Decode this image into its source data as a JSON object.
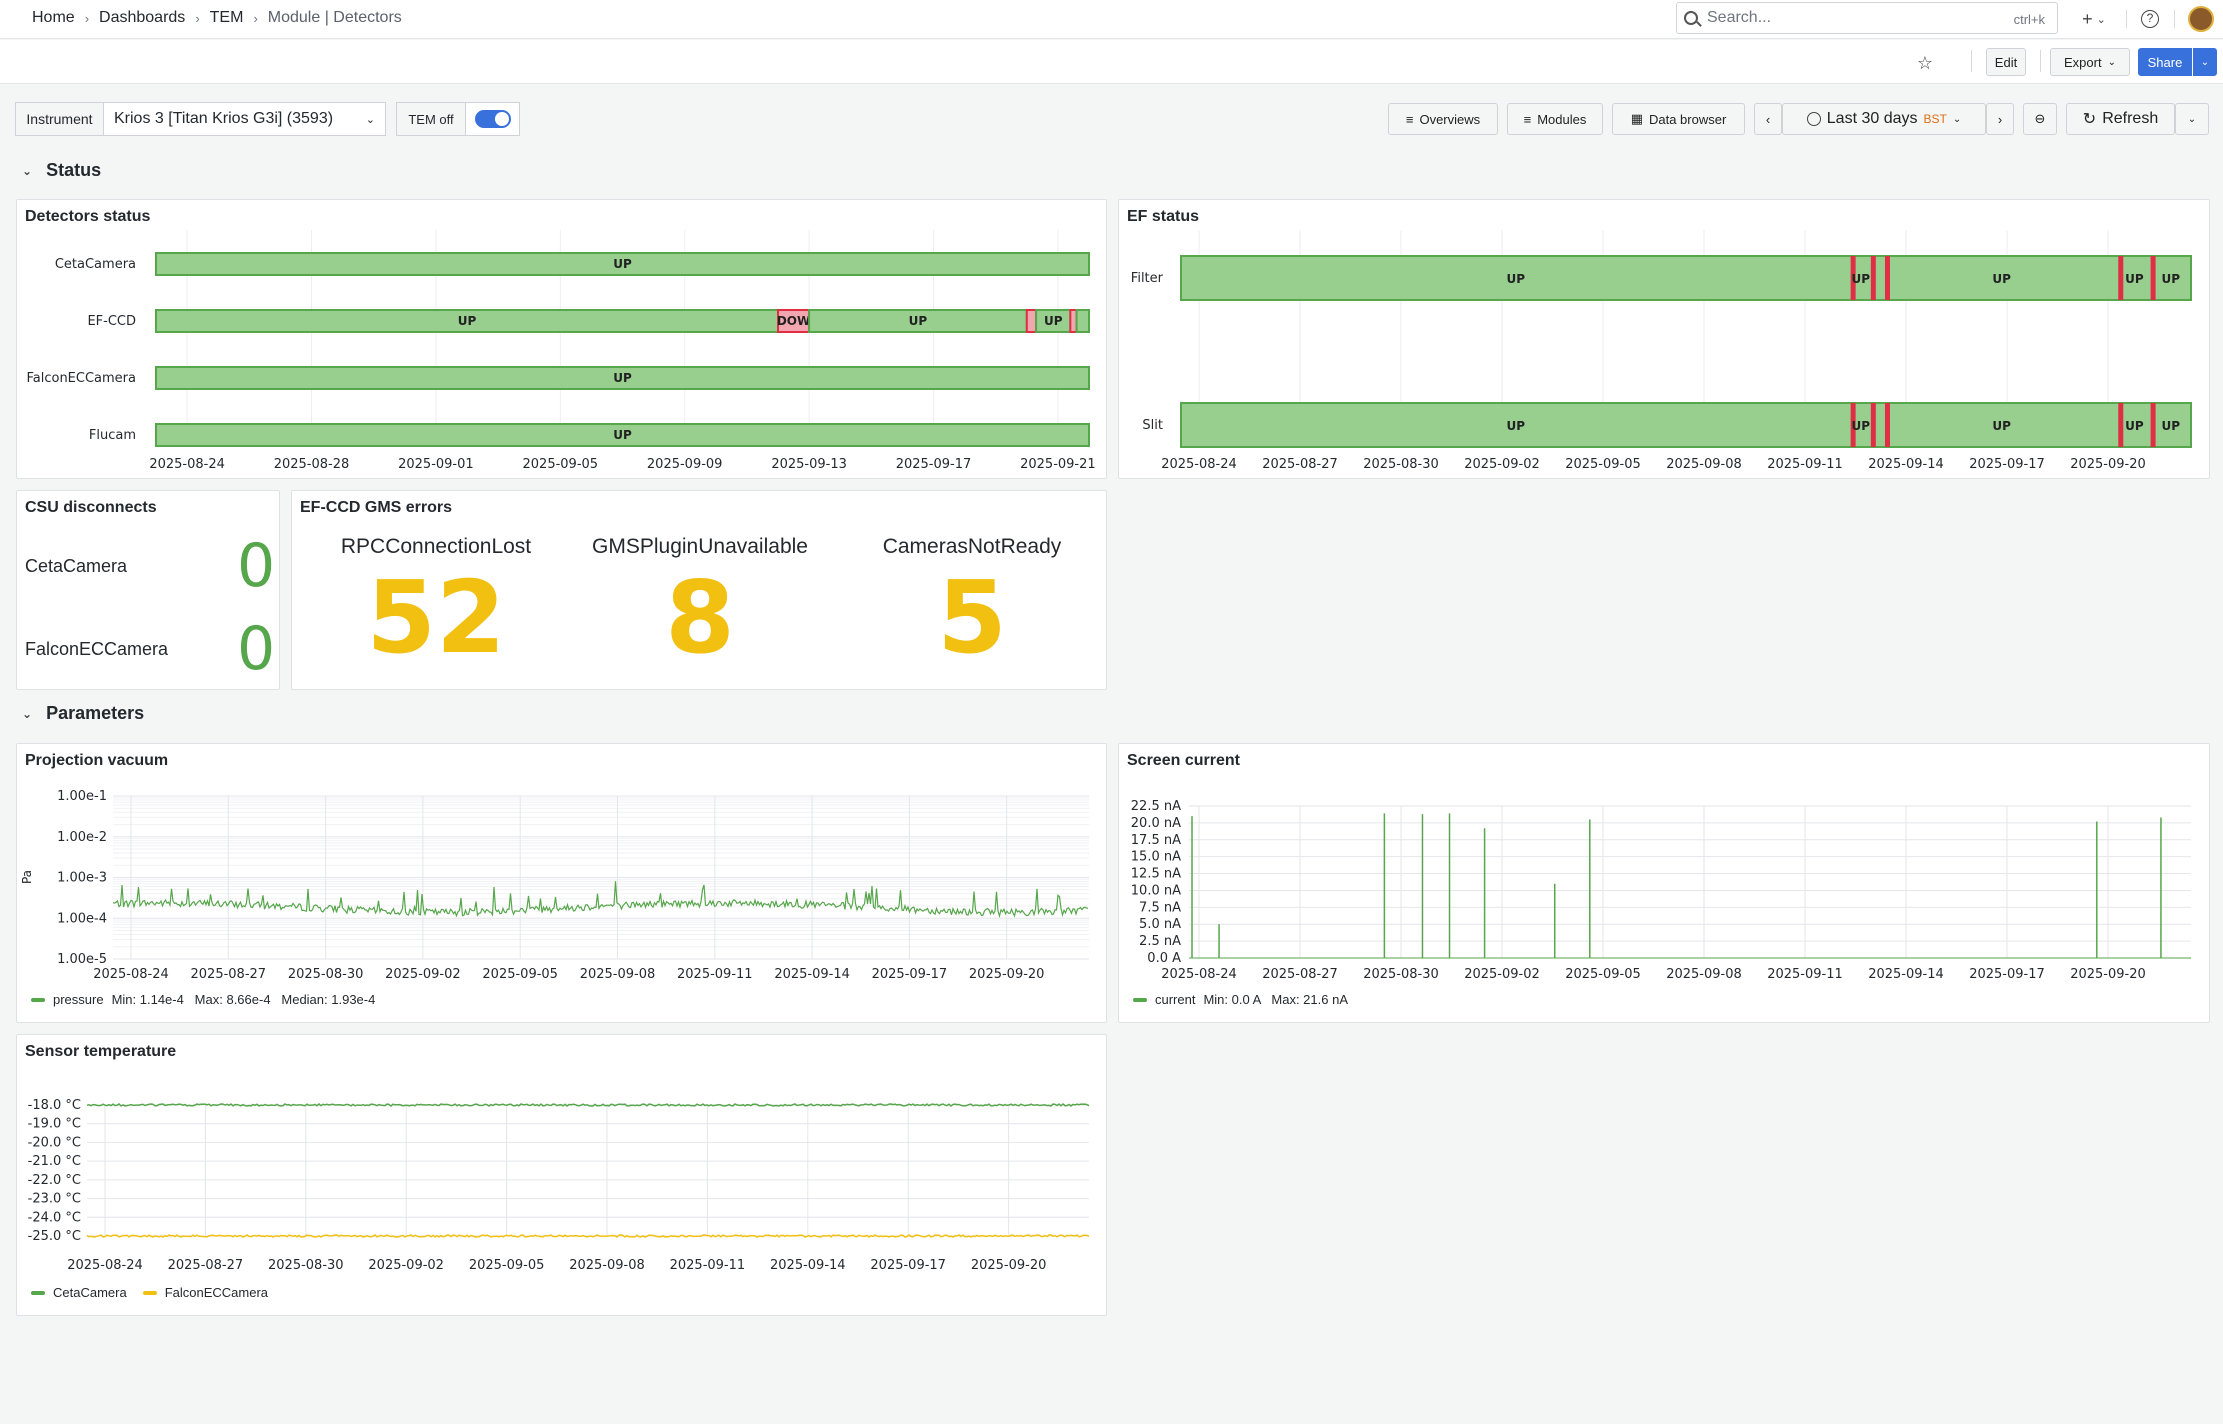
{
  "breadcrumb": {
    "items": [
      "Home",
      "Dashboards",
      "TEM"
    ],
    "current": "Module | Detectors"
  },
  "search": {
    "placeholder": "Search...",
    "shortcut": "ctrl+k"
  },
  "toolbar": {
    "edit": "Edit",
    "export": "Export",
    "share": "Share"
  },
  "controls": {
    "instrument_label": "Instrument",
    "instrument_value": "Krios 3 [Titan Krios G3i] (3593)",
    "tem_off": "TEM off",
    "tem_toggle_on": true,
    "overviews": "Overviews",
    "modules": "Modules",
    "data_browser": "Data browser",
    "time_range": "Last 30 days",
    "timezone": "BST",
    "refresh": "Refresh"
  },
  "colors": {
    "ok": "#56a64b",
    "ok_fill": "#98cf8f",
    "down": "#e02f44",
    "down_fill": "#f2a7b0",
    "warn": "#f2c011",
    "accent": "#3871dc"
  },
  "sections": {
    "status": "Status",
    "parameters": "Parameters"
  },
  "panels": {
    "detectors_status": {
      "title": "Detectors status"
    },
    "ef_status": {
      "title": "EF status"
    },
    "csu": {
      "title": "CSU disconnects",
      "items": [
        {
          "label": "CetaCamera",
          "value": "0"
        },
        {
          "label": "FalconECCamera",
          "value": "0"
        }
      ]
    },
    "gms": {
      "title": "EF-CCD GMS errors",
      "items": [
        {
          "label": "RPCConnectionLost",
          "value": "52"
        },
        {
          "label": "GMSPluginUnavailable",
          "value": "8"
        },
        {
          "label": "CamerasNotReady",
          "value": "5"
        }
      ]
    },
    "projection_vacuum": {
      "title": "Projection vacuum",
      "legend": "pressure",
      "stats": "Min: 1.14e-4   Max: 8.66e-4   Median: 1.93e-4"
    },
    "screen_current": {
      "title": "Screen current",
      "legend": "current",
      "stats": "Min: 0.0 A   Max: 21.6 nA"
    },
    "sensor_temp": {
      "title": "Sensor temperature",
      "legend": [
        "CetaCamera",
        "FalconECCamera"
      ]
    }
  },
  "chart_data": [
    {
      "type": "state-timeline",
      "title": "Detectors status",
      "x_ticks": [
        "2025-08-24",
        "2025-08-28",
        "2025-09-01",
        "2025-09-05",
        "2025-09-09",
        "2025-09-13",
        "2025-09-17",
        "2025-09-21"
      ],
      "rows": [
        {
          "name": "CetaCamera",
          "segments": [
            {
              "state": "UP",
              "from": "2025-08-23",
              "to": "2025-09-22"
            }
          ]
        },
        {
          "name": "EF-CCD",
          "segments": [
            {
              "state": "UP",
              "from": "2025-08-23",
              "to": "2025-09-12"
            },
            {
              "state": "DOWN",
              "label": "DOW",
              "from": "2025-09-12",
              "to": "2025-09-13"
            },
            {
              "state": "UP",
              "from": "2025-09-13",
              "to": "2025-09-20"
            },
            {
              "state": "DOWN",
              "from": "2025-09-20",
              "to": "2025-09-20.3"
            },
            {
              "state": "UP",
              "from": "2025-09-20.3",
              "to": "2025-09-21.4"
            },
            {
              "state": "DOWN",
              "from": "2025-09-21.4",
              "to": "2025-09-21.6"
            },
            {
              "state": "UP",
              "from": "2025-09-21.6",
              "to": "2025-09-22"
            }
          ]
        },
        {
          "name": "FalconECCamera",
          "segments": [
            {
              "state": "UP",
              "from": "2025-08-23",
              "to": "2025-09-22"
            }
          ]
        },
        {
          "name": "Flucam",
          "segments": [
            {
              "state": "UP",
              "from": "2025-08-23",
              "to": "2025-09-22"
            }
          ]
        }
      ]
    },
    {
      "type": "state-timeline",
      "title": "EF status",
      "x_ticks": [
        "2025-08-24",
        "2025-08-27",
        "2025-08-30",
        "2025-09-02",
        "2025-09-05",
        "2025-09-08",
        "2025-09-11",
        "2025-09-14",
        "2025-09-17",
        "2025-09-20"
      ],
      "rows": [
        {
          "name": "Filter",
          "up_labels": [
            "UP",
            "UP",
            "UP",
            "UP",
            "UP"
          ]
        },
        {
          "name": "Slit",
          "up_labels": [
            "UP",
            "UP",
            "UP",
            "UP",
            "UP"
          ]
        }
      ]
    },
    {
      "type": "line",
      "title": "Projection vacuum",
      "ylabel": "Pa",
      "y_scale": "log",
      "y_ticks": [
        "1.00e-1",
        "1.00e-2",
        "1.00e-3",
        "1.00e-4",
        "1.00e-5"
      ],
      "x_ticks": [
        "2025-08-24",
        "2025-08-27",
        "2025-08-30",
        "2025-09-02",
        "2025-09-05",
        "2025-09-08",
        "2025-09-11",
        "2025-09-14",
        "2025-09-17",
        "2025-09-20"
      ],
      "series": [
        {
          "name": "pressure",
          "min": 0.000114,
          "max": 0.000866,
          "median": 0.000193
        }
      ]
    },
    {
      "type": "line",
      "title": "Screen current",
      "y_ticks": [
        "22.5 nA",
        "20.0 nA",
        "17.5 nA",
        "15.0 nA",
        "12.5 nA",
        "10.0 nA",
        "7.5 nA",
        "5.0 nA",
        "2.5 nA",
        "0.0 A"
      ],
      "x_ticks": [
        "2025-08-24",
        "2025-08-27",
        "2025-08-30",
        "2025-09-02",
        "2025-09-05",
        "2025-09-08",
        "2025-09-11",
        "2025-09-14",
        "2025-09-17",
        "2025-09-20"
      ],
      "series": [
        {
          "name": "current",
          "min": 0,
          "max": 21.6,
          "spikes": [
            {
              "x": 0.003,
              "y": 21
            },
            {
              "x": 0.03,
              "y": 5
            },
            {
              "x": 0.195,
              "y": 21.4
            },
            {
              "x": 0.233,
              "y": 21.3
            },
            {
              "x": 0.26,
              "y": 21.4
            },
            {
              "x": 0.295,
              "y": 19.2
            },
            {
              "x": 0.365,
              "y": 11
            },
            {
              "x": 0.4,
              "y": 20.5
            },
            {
              "x": 0.906,
              "y": 20.2
            },
            {
              "x": 0.97,
              "y": 20.8
            }
          ]
        }
      ]
    },
    {
      "type": "line",
      "title": "Sensor temperature",
      "y_ticks": [
        "-18.0 °C",
        "-19.0 °C",
        "-20.0 °C",
        "-21.0 °C",
        "-22.0 °C",
        "-23.0 °C",
        "-24.0 °C",
        "-25.0 °C"
      ],
      "x_ticks": [
        "2025-08-24",
        "2025-08-27",
        "2025-08-30",
        "2025-09-02",
        "2025-09-05",
        "2025-09-08",
        "2025-09-11",
        "2025-09-14",
        "2025-09-17",
        "2025-09-20"
      ],
      "series": [
        {
          "name": "CetaCamera",
          "value": -18.0
        },
        {
          "name": "FalconECCamera",
          "value": -25.0
        }
      ]
    }
  ]
}
